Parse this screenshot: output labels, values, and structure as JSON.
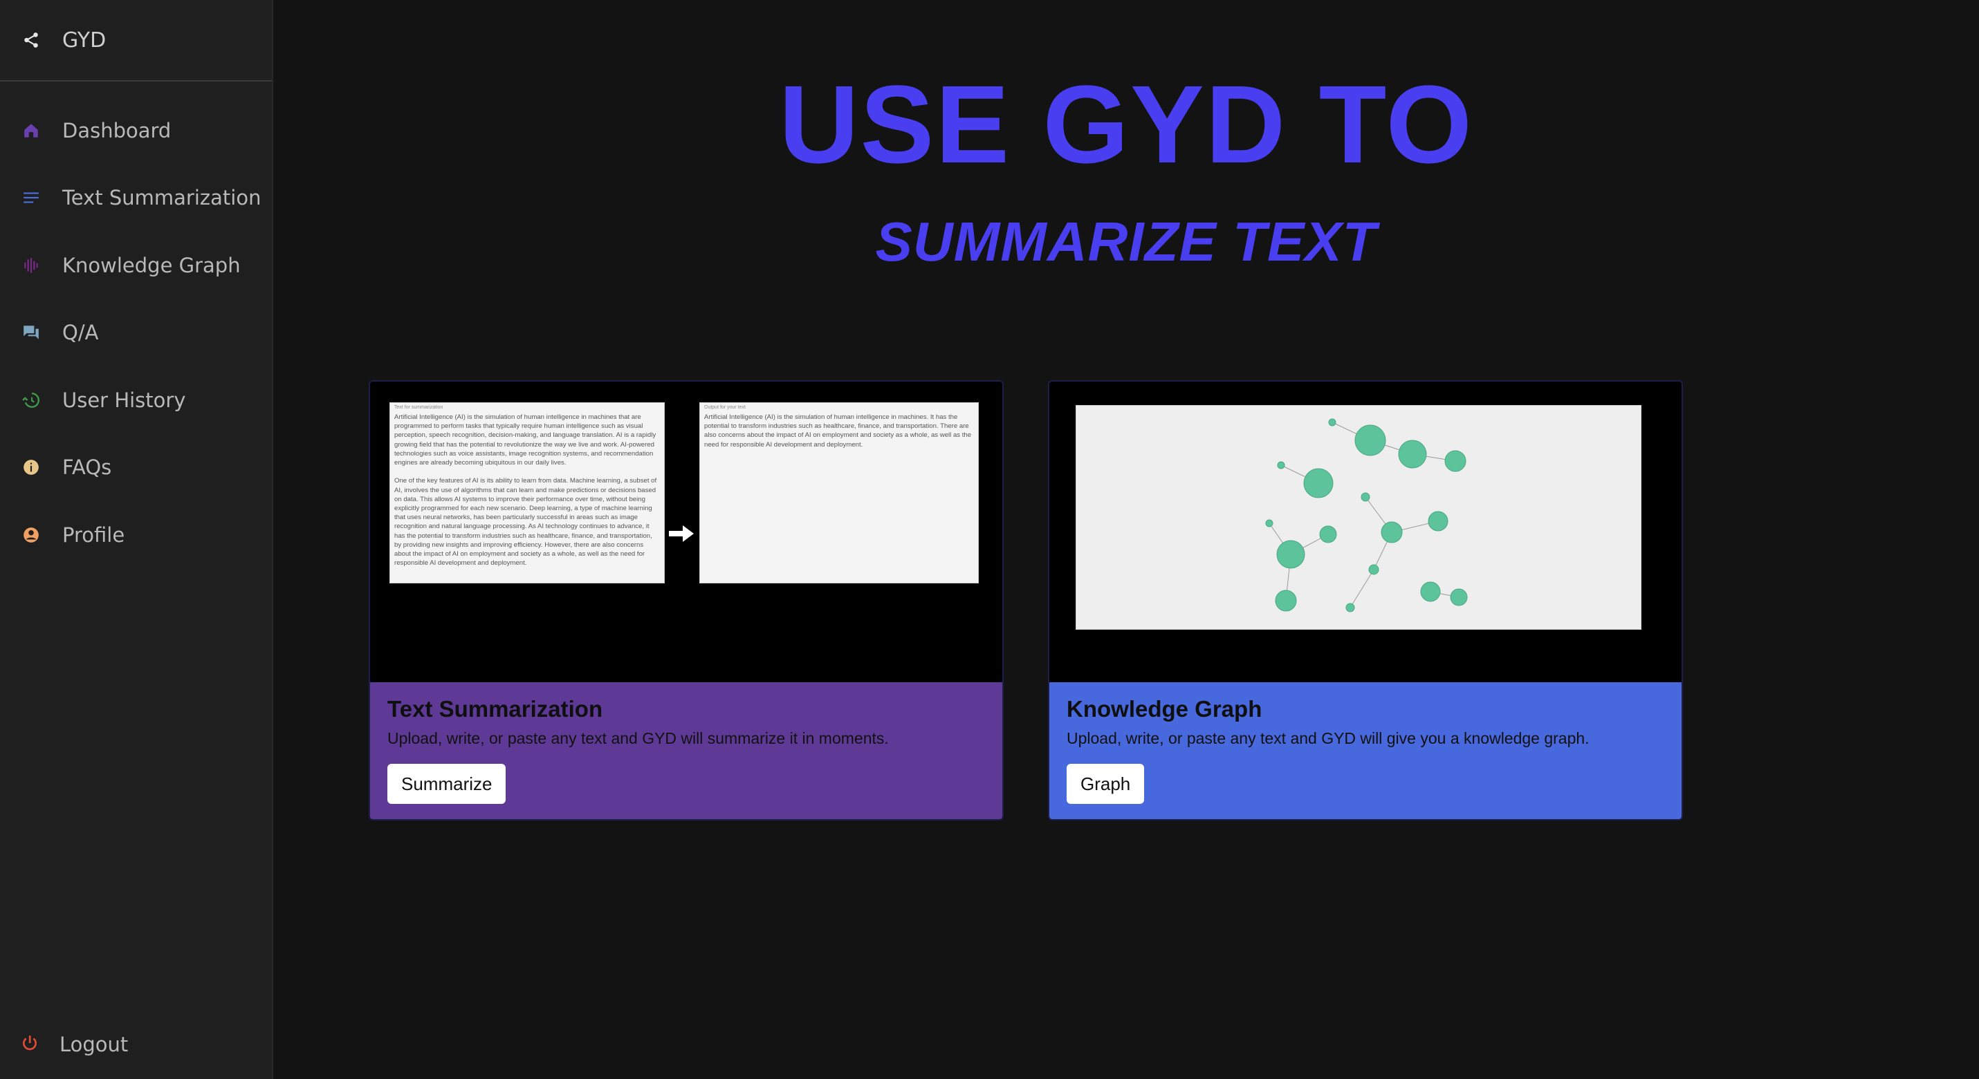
{
  "brand": {
    "label": "GYD",
    "icon": "share-icon"
  },
  "nav": [
    {
      "label": "Dashboard",
      "icon": "home-icon",
      "color": "#6a3fb0"
    },
    {
      "label": "Text Summarization",
      "icon": "text-lines-icon",
      "color": "#4a6fdc"
    },
    {
      "label": "Knowledge Graph",
      "icon": "waveform-icon",
      "color": "#7a2a8a"
    },
    {
      "label": "Q/A",
      "icon": "chat-icon",
      "color": "#7ea6c0"
    },
    {
      "label": "User History",
      "icon": "history-icon",
      "color": "#3f9a4a"
    },
    {
      "label": "FAQs",
      "icon": "info-icon",
      "color": "#e8c68a"
    },
    {
      "label": "Profile",
      "icon": "profile-icon",
      "color": "#f0a060"
    }
  ],
  "logout": {
    "label": "Logout",
    "icon": "power-icon",
    "color": "#e84a3a"
  },
  "hero": {
    "title": "USE GYD TO",
    "subtitle": "SUMMARIZE TEXT",
    "color": "#4a3ff0"
  },
  "cards": {
    "summarization": {
      "title": "Text Summarization",
      "description": "Upload, write, or paste any text and GYD will summarize it in moments.",
      "button": "Summarize",
      "color": "#5e3a96",
      "input_placeholder": "Text for summarization",
      "input_text": "Artificial Intelligence (AI) is the simulation of human intelligence in machines that are programmed to perform tasks that typically require human intelligence such as visual perception, speech recognition, decision-making, and language translation. AI is a rapidly growing field that has the potential to revolutionize the way we live and work. AI-powered technologies such as voice assistants, image recognition systems, and recommendation engines are already becoming ubiquitous in our daily lives.\n\nOne of the key features of AI is its ability to learn from data. Machine learning, a subset of AI, involves the use of algorithms that can learn and make predictions or decisions based on data. This allows AI systems to improve their performance over time, without being explicitly programmed for each new scenario. Deep learning, a type of machine learning that uses neural networks, has been particularly successful in areas such as image recognition and natural language processing. As AI technology continues to advance, it has the potential to transform industries such as healthcare, finance, and transportation, by providing new insights and improving efficiency. However, there are also concerns about the impact of AI on employment and society as a whole, as well as the need for responsible AI development and deployment.",
      "output_placeholder": "Output for your text",
      "output_text": "Artificial Intelligence (AI) is the simulation of human intelligence in machines. It has the potential to transform industries such as healthcare, finance, and transportation. There are also concerns about the impact of AI on employment and society as a whole, as well as the need for responsible AI development and deployment."
    },
    "graph": {
      "title": "Knowledge Graph",
      "description": "Upload, write, or paste any text and GYD will give you a knowledge graph.",
      "button": "Graph",
      "color": "#4769dd",
      "node_color": "#5cc39a"
    }
  }
}
